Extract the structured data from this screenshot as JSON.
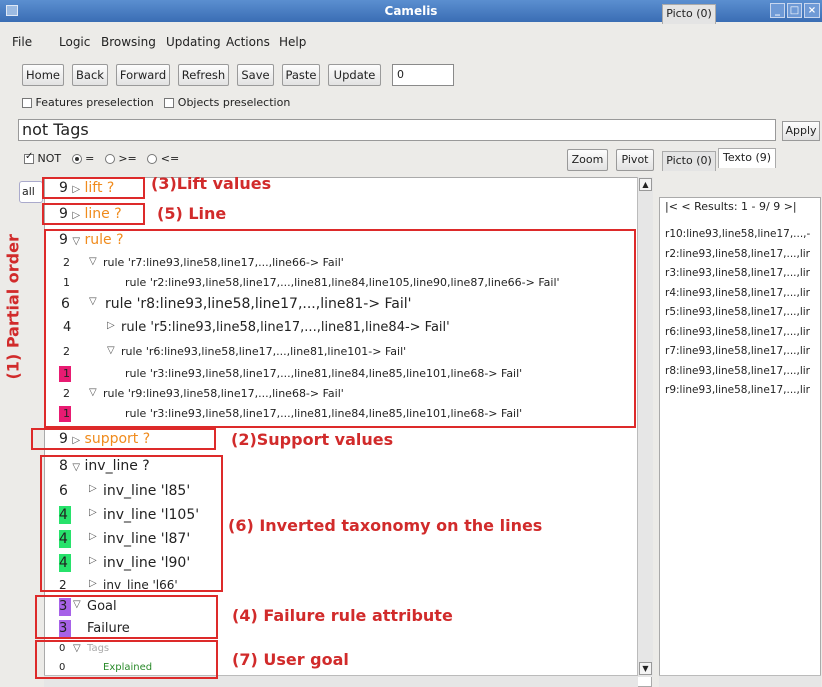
{
  "window": {
    "title": "Camelis"
  },
  "menu": [
    "File",
    "Logic",
    "Browsing",
    "Updating",
    "Actions",
    "Help"
  ],
  "toolbar": {
    "home": "Home",
    "back": "Back",
    "forward": "Forward",
    "refresh": "Refresh",
    "save": "Save",
    "paste": "Paste",
    "update": "Update",
    "field_value": "0"
  },
  "preselection": {
    "features": "Features preselection",
    "objects": "Objects preselection"
  },
  "query": {
    "value": "not Tags",
    "apply": "Apply"
  },
  "operators": {
    "not": "NOT",
    "eq": "=",
    "ge": ">=",
    "le": "<=",
    "zoom": "Zoom",
    "pivot": "Pivot"
  },
  "left_tab": "all",
  "tree": {
    "lift": {
      "count": "9",
      "label": "lift ?"
    },
    "line": {
      "count": "9",
      "label": "line ?"
    },
    "rule": {
      "count": "9",
      "label": "rule ?"
    },
    "rule_items": [
      {
        "count": "2",
        "label": "rule 'r7:line93,line58,line17,...,line66-> Fail'"
      },
      {
        "count": "1",
        "label": "rule 'r2:line93,line58,line17,...,line81,line84,line105,line90,line87,line66-> Fail'"
      },
      {
        "count": "6",
        "label": "rule 'r8:line93,line58,line17,...,line81-> Fail'"
      },
      {
        "count": "4",
        "label": "rule 'r5:line93,line58,line17,...,line81,line84-> Fail'"
      },
      {
        "count": "2",
        "label": "rule 'r6:line93,line58,line17,...,line81,line101-> Fail'"
      },
      {
        "count": "1",
        "label": "rule 'r3:line93,line58,line17,...,line81,line84,line85,line101,line68-> Fail'"
      },
      {
        "count": "2",
        "label": "rule 'r9:line93,line58,line17,...,line68-> Fail'"
      },
      {
        "count": "1",
        "label": "rule 'r3:line93,line58,line17,...,line81,line84,line85,line101,line68-> Fail'"
      }
    ],
    "support": {
      "count": "9",
      "label": "support ?"
    },
    "inv_line": {
      "count": "8",
      "label": "inv_line ?"
    },
    "inv_items": [
      {
        "count": "6",
        "label": "inv_line 'l85'"
      },
      {
        "count": "4",
        "label": "inv_line 'l105'"
      },
      {
        "count": "4",
        "label": "inv_line 'l87'"
      },
      {
        "count": "4",
        "label": "inv_line 'l90'"
      },
      {
        "count": "2",
        "label": "inv_line 'l66'"
      }
    ],
    "goal": {
      "count": "3",
      "label": "Goal"
    },
    "failure": {
      "count": "3",
      "label": "Failure"
    },
    "tags": {
      "count": "0",
      "label": "Tags"
    },
    "explained": {
      "count": "0",
      "label": "Explained"
    }
  },
  "annotations": {
    "a1": "(1) Partial order",
    "a2": "(2)Support values",
    "a3": "(3)Lift values",
    "a4": "(4) Failure rule attribute",
    "a5": "(5) Line",
    "a6": "(6) Inverted taxonomy on the lines",
    "a7": "(7) User goal"
  },
  "right": {
    "tab_picto": "Picto (0)",
    "tab_texto": "Texto (9)",
    "nav": "|<  < Results: 1 - 9/ 9 >|",
    "results": [
      "r10:line93,line58,line17,...,-",
      "r2:line93,line58,line17,...,lir",
      "r3:line93,line58,line17,...,lir",
      "r4:line93,line58,line17,...,lir",
      "r5:line93,line58,line17,...,lir",
      "r6:line93,line58,line17,...,lir",
      "r7:line93,line58,line17,...,lir",
      "r8:line93,line58,line17,...,lir",
      "r9:line93,line58,line17,...,lir"
    ]
  },
  "colors": {
    "orange": "#f08b1c",
    "pink": "#e81b72",
    "green": "#27e26b",
    "purple": "#a762e8",
    "annotation_red": "#d12b2b"
  }
}
